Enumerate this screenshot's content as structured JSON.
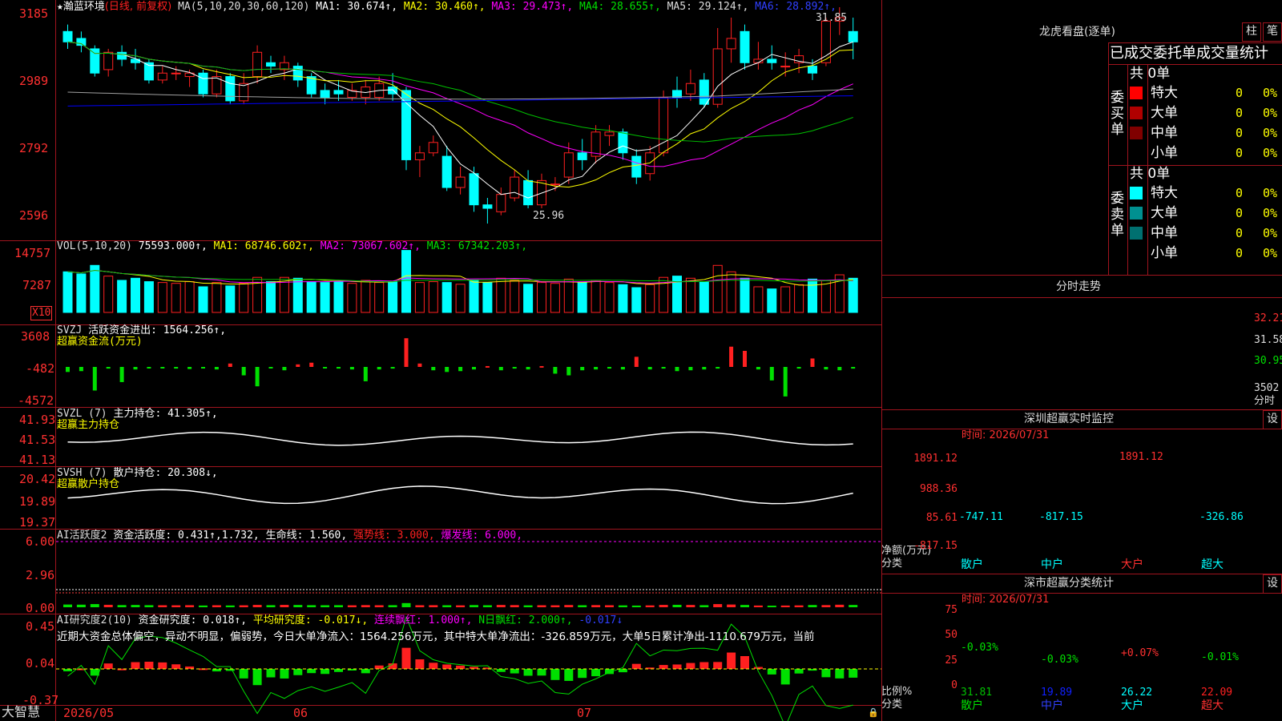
{
  "chart_header": {
    "star": "★",
    "stock_name": "瀚蓝环境",
    "mode": "(日线, 前复权)",
    "ma_label": "MA(5,10,20,30,60,120)",
    "ma1": "MA1: 30.674↑,",
    "ma2": "MA2: 30.460↑,",
    "ma3": "MA3: 29.473↑,",
    "ma4": "MA4: 28.655↑,",
    "ma5": "MA5: 29.124↑,",
    "ma6": "MA6: 28.892↑,",
    "high_mark": "31.85",
    "low_mark": "25.96"
  },
  "price_axis": [
    "3185",
    "2989",
    "2792",
    "2596"
  ],
  "vol_header": {
    "label": "VOL(5,10,20)",
    "value": "75593.000↑,",
    "ma1": "MA1: 68746.602↑,",
    "ma2": "MA2: 73067.602↑,",
    "ma3": "MA3: 67342.203↑,"
  },
  "vol_axis": [
    "14757",
    "7287"
  ],
  "vol_unit": "X10",
  "svzj_header": {
    "label": "SVZJ",
    "title": "活跃资金进出: 1564.256↑,",
    "subtitle": "超赢资金流(万元)"
  },
  "svzj_axis": [
    "3608",
    "-482",
    "-4572"
  ],
  "svzl_header": {
    "label": "SVZL (7)",
    "title": "主力持仓: 41.305↑,",
    "subtitle": "超赢主力持仓"
  },
  "svzl_axis": [
    "41.93",
    "41.53",
    "41.13"
  ],
  "svsh_header": {
    "label": "SVSH (7)",
    "title": "散户持仓: 20.308↓,",
    "subtitle": "超赢散户持仓"
  },
  "svsh_axis": [
    "20.42",
    "19.89",
    "19.37"
  ],
  "ai1_header": {
    "label": "AI活跃度2",
    "title": "资金活跃度: 0.431↑,",
    "v2": "1.732,",
    "v3": "生命线: 1.560,",
    "v4": "强势线: 3.000,",
    "v5": "爆发线: 6.000,"
  },
  "ai1_axis": [
    "6.00",
    "2.96",
    "0.00"
  ],
  "ai2_header": {
    "label": "AI研究度2(10)",
    "title": "资金研究度: 0.018↑,",
    "v2": "平均研究度: -0.017↓,",
    "v3": "连续飘红: 1.000↑,",
    "v4": "N日飘红: 2.000↑,",
    "v5": "-0.017↓"
  },
  "ai2_text": "近期大资金总体偏空，异动不明显，偏弱势，今日大单净流入：1564.256万元，其中特大单净流出：-326.859万元，大单5日累计净出-1110.679万元，当前",
  "ai2_axis": [
    "0.45",
    "0.04",
    "-0.37"
  ],
  "date_axis": [
    "2026/05",
    "06",
    "07"
  ],
  "brand": "大智慧",
  "right_panel": {
    "lhb_title": "龙虎看盘(逐单)",
    "btn_bar": "柱",
    "btn_pen": "笔",
    "stats_title": "已成交委托单成交量统计",
    "buy_label": "委买单",
    "buy_total": "共 0单",
    "buy_rows": [
      {
        "name": "特大",
        "value": "0",
        "pct": "0%",
        "color": "#ff0000"
      },
      {
        "name": "大单",
        "value": "0",
        "pct": "0%",
        "color": "#b00000"
      },
      {
        "name": "中单",
        "value": "0",
        "pct": "0%",
        "color": "#800000"
      },
      {
        "name": "小单",
        "value": "0",
        "pct": "0%",
        "color": "#000000"
      }
    ],
    "sell_label": "委卖单",
    "sell_total": "共 0单",
    "sell_rows": [
      {
        "name": "特大",
        "value": "0",
        "pct": "0%",
        "color": "#00ffff"
      },
      {
        "name": "大单",
        "value": "0",
        "pct": "0%",
        "color": "#009090"
      },
      {
        "name": "中单",
        "value": "0",
        "pct": "0%",
        "color": "#007070"
      },
      {
        "name": "小单",
        "value": "0",
        "pct": "0%",
        "color": "#000000"
      }
    ],
    "timeshare_title": "分时走势",
    "timeshare_axis": [
      "32.21",
      "31.58",
      "30.95",
      "3502"
    ],
    "timeshare_unit": "分时",
    "sz_monitor_title": "深圳超赢实时监控",
    "settings": "设",
    "monitor_time": "时间: 2026/07/31",
    "monitor_axis": [
      "1891.12",
      "988.36",
      "85.61",
      "-817.15"
    ],
    "monitor_ylabel": "净额(万元)",
    "monitor_xlabel": "分类",
    "monitor_bars": [
      {
        "cat": "散户",
        "value": -747.11,
        "label": "-747.11"
      },
      {
        "cat": "中户",
        "value": -817.15,
        "label": "-817.15"
      },
      {
        "cat": "大户",
        "value": 1891.12,
        "label": "1891.12"
      },
      {
        "cat": "超大",
        "value": -326.86,
        "label": "-326.86"
      }
    ],
    "sz_stat_title": "深市超赢分类统计",
    "stat_time": "时间: 2026/07/31",
    "stat_axis": [
      "75",
      "50",
      "25",
      "0"
    ],
    "stat_ylabel": "比例%",
    "stat_xlabel": "分类",
    "stat_bars": [
      {
        "cat": "散户",
        "value": 31.81,
        "change": "-0.03%",
        "label": "31.81",
        "color": "#00c000"
      },
      {
        "cat": "中户",
        "value": 19.89,
        "change": "-0.03%",
        "label": "19.89",
        "color": "#1020ff"
      },
      {
        "cat": "大户",
        "value": 26.22,
        "change": "+0.07%",
        "label": "26.22",
        "color": "#00ffff"
      },
      {
        "cat": "超大",
        "value": 22.09,
        "change": "-0.01%",
        "label": "22.09",
        "color": "#ff2020"
      }
    ]
  },
  "colors": {
    "up": "#ff2020",
    "down": "#00ffff",
    "ma1": "#ffffff",
    "ma2": "#ffff00",
    "ma3": "#ff00ff",
    "ma4": "#00c000",
    "ma5": "#a0a0a0",
    "ma6": "#0000ff",
    "grid": "#a0141e"
  },
  "chart_data": {
    "type": "candlestick",
    "title": "瀚蓝环境 (日线, 前复权)",
    "ylim": [
      25.3,
      32.3
    ],
    "x_labels": [
      "2026/05",
      "06",
      "07"
    ],
    "candles": [
      [
        31.5,
        31.2,
        31.7,
        31.0
      ],
      [
        31.3,
        31.1,
        31.5,
        30.9
      ],
      [
        31.0,
        30.3,
        31.1,
        30.2
      ],
      [
        30.4,
        30.9,
        31.0,
        30.2
      ],
      [
        30.9,
        30.7,
        31.1,
        30.5
      ],
      [
        30.7,
        30.6,
        31.0,
        30.4
      ],
      [
        30.6,
        30.1,
        30.7,
        30.0
      ],
      [
        30.1,
        30.3,
        30.5,
        30.0
      ],
      [
        30.3,
        30.3,
        30.5,
        30.1
      ],
      [
        30.2,
        30.3,
        30.4,
        29.9
      ],
      [
        30.3,
        29.7,
        30.4,
        29.6
      ],
      [
        29.7,
        30.2,
        30.4,
        29.6
      ],
      [
        30.2,
        29.5,
        30.3,
        29.4
      ],
      [
        29.5,
        30.0,
        30.3,
        29.4
      ],
      [
        30.2,
        30.9,
        31.1,
        30.0
      ],
      [
        30.6,
        30.5,
        30.8,
        30.3
      ],
      [
        30.4,
        30.6,
        30.8,
        30.1
      ],
      [
        30.5,
        30.1,
        30.6,
        29.9
      ],
      [
        30.2,
        29.7,
        30.3,
        29.6
      ],
      [
        29.8,
        29.6,
        30.0,
        29.4
      ],
      [
        29.8,
        29.7,
        30.1,
        29.5
      ],
      [
        29.6,
        29.8,
        30.0,
        29.5
      ],
      [
        29.6,
        29.9,
        30.1,
        29.4
      ],
      [
        29.6,
        30.0,
        30.2,
        29.5
      ],
      [
        29.9,
        29.7,
        30.3,
        29.5
      ],
      [
        29.8,
        27.8,
        29.9,
        27.5
      ],
      [
        27.8,
        28.0,
        28.2,
        27.3
      ],
      [
        28.0,
        28.3,
        28.5,
        27.9
      ],
      [
        27.9,
        27.0,
        28.2,
        26.9
      ],
      [
        27.0,
        27.3,
        27.6,
        26.8
      ],
      [
        27.4,
        26.5,
        27.6,
        26.3
      ],
      [
        26.5,
        26.4,
        26.7,
        25.96
      ],
      [
        26.3,
        26.8,
        27.0,
        26.2
      ],
      [
        26.7,
        27.3,
        27.5,
        26.6
      ],
      [
        27.2,
        26.5,
        27.5,
        26.4
      ],
      [
        26.5,
        27.2,
        27.4,
        26.4
      ],
      [
        27.1,
        27.1,
        27.3,
        26.9
      ],
      [
        27.3,
        28.0,
        28.3,
        27.1
      ],
      [
        28.0,
        27.8,
        28.4,
        27.5
      ],
      [
        27.9,
        28.6,
        28.8,
        27.7
      ],
      [
        28.5,
        28.6,
        28.8,
        28.2
      ],
      [
        28.6,
        28.0,
        28.7,
        27.8
      ],
      [
        27.9,
        27.3,
        28.1,
        27.1
      ],
      [
        27.4,
        28.0,
        28.2,
        27.2
      ],
      [
        28.0,
        29.6,
        29.8,
        27.9
      ],
      [
        29.8,
        29.6,
        30.2,
        29.3
      ],
      [
        29.7,
        30.0,
        30.4,
        29.5
      ],
      [
        30.1,
        29.4,
        30.3,
        29.3
      ],
      [
        29.4,
        31.0,
        31.6,
        29.3
      ],
      [
        31.0,
        31.3,
        31.9,
        30.6
      ],
      [
        31.5,
        30.6,
        31.7,
        30.4
      ],
      [
        30.6,
        30.7,
        31.2,
        30.4
      ],
      [
        30.7,
        30.6,
        31.1,
        30.4
      ],
      [
        30.5,
        30.5,
        30.9,
        30.2
      ],
      [
        30.6,
        30.8,
        31.0,
        30.3
      ],
      [
        30.5,
        30.3,
        30.7,
        30.1
      ],
      [
        30.6,
        31.8,
        31.9,
        30.5
      ],
      [
        31.8,
        31.9,
        32.2,
        31.4
      ],
      [
        31.5,
        31.2,
        31.9,
        30.7
      ]
    ],
    "volume": [
      95,
      90,
      110,
      85,
      75,
      80,
      72,
      70,
      68,
      72,
      60,
      70,
      62,
      68,
      82,
      72,
      82,
      80,
      72,
      70,
      72,
      68,
      75,
      70,
      72,
      145,
      70,
      72,
      70,
      66,
      76,
      70,
      80,
      75,
      66,
      70,
      68,
      78,
      70,
      75,
      70,
      65,
      58,
      65,
      82,
      85,
      80,
      72,
      110,
      95,
      80,
      60,
      55,
      60,
      65,
      78,
      75,
      88,
      80
    ],
    "fund_flow": [
      -600,
      -500,
      -2800,
      -200,
      -1800,
      -300,
      -150,
      -100,
      -200,
      -250,
      -150,
      -300,
      400,
      -1000,
      -2300,
      -150,
      -400,
      300,
      500,
      -150,
      -200,
      -300,
      -1700,
      -300,
      -200,
      3400,
      400,
      -400,
      -600,
      -500,
      -300,
      100,
      -400,
      -200,
      -300,
      100,
      -800,
      -1000,
      -400,
      -300,
      -200,
      -300,
      1200,
      -300,
      -200,
      -500,
      -400,
      -300,
      -200,
      2400,
      1900,
      -300,
      -1600,
      -3500,
      -200,
      1000,
      -300,
      -400,
      -200,
      -500,
      1600
    ]
  }
}
